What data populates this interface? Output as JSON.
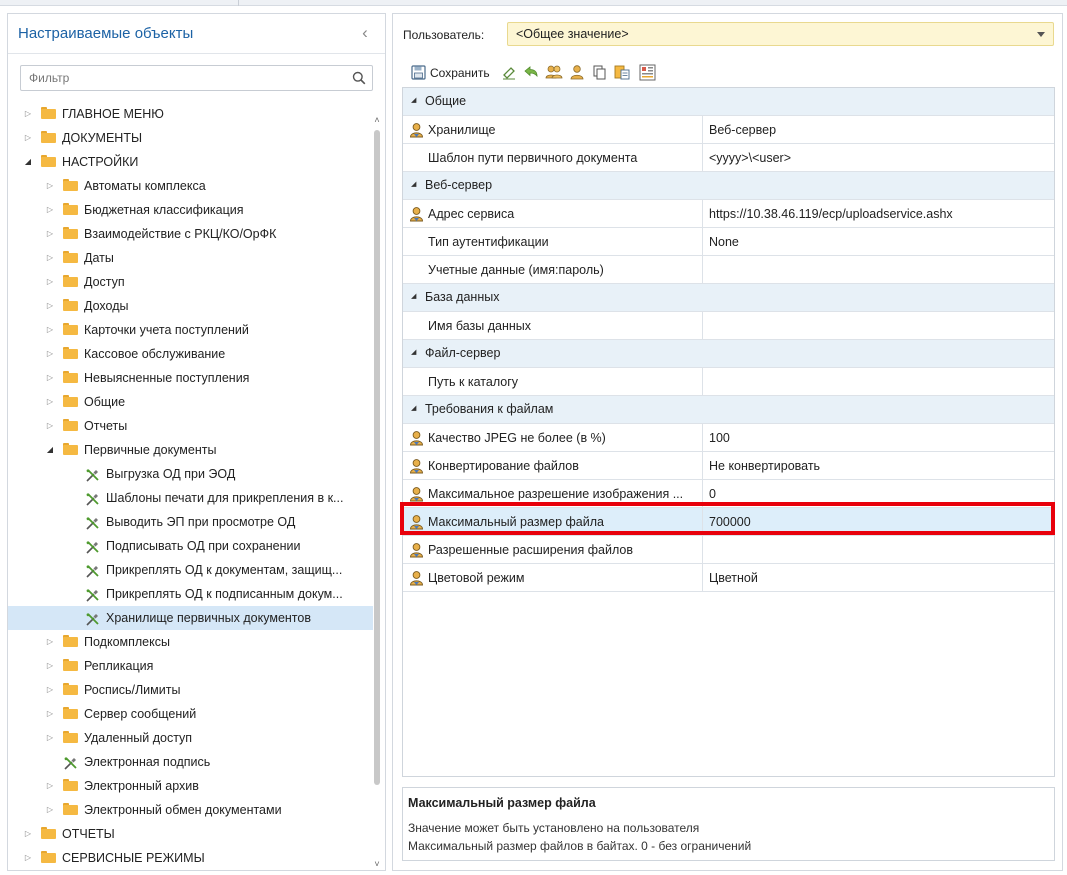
{
  "left_panel": {
    "title": "Настраиваемые объекты",
    "filter_placeholder": "Фильтр",
    "tree": [
      {
        "label": "ГЛАВНОЕ МЕНЮ",
        "level": 0,
        "type": "folder",
        "expanded": false
      },
      {
        "label": "ДОКУМЕНТЫ",
        "level": 0,
        "type": "folder",
        "expanded": false
      },
      {
        "label": "НАСТРОЙКИ",
        "level": 0,
        "type": "folder",
        "expanded": true
      },
      {
        "label": "Автоматы комплекса",
        "level": 1,
        "type": "folder",
        "expanded": false
      },
      {
        "label": "Бюджетная классификация",
        "level": 1,
        "type": "folder",
        "expanded": false
      },
      {
        "label": "Взаимодействие с РКЦ/КО/ОрФК",
        "level": 1,
        "type": "folder",
        "expanded": false
      },
      {
        "label": "Даты",
        "level": 1,
        "type": "folder",
        "expanded": false
      },
      {
        "label": "Доступ",
        "level": 1,
        "type": "folder",
        "expanded": false
      },
      {
        "label": "Доходы",
        "level": 1,
        "type": "folder",
        "expanded": false
      },
      {
        "label": "Карточки учета поступлений",
        "level": 1,
        "type": "folder",
        "expanded": false
      },
      {
        "label": "Кассовое обслуживание",
        "level": 1,
        "type": "folder",
        "expanded": false
      },
      {
        "label": "Невыясненные поступления",
        "level": 1,
        "type": "folder",
        "expanded": false
      },
      {
        "label": "Общие",
        "level": 1,
        "type": "folder",
        "expanded": false
      },
      {
        "label": "Отчеты",
        "level": 1,
        "type": "folder",
        "expanded": false
      },
      {
        "label": "Первичные документы",
        "level": 1,
        "type": "folder",
        "expanded": true
      },
      {
        "label": "Выгрузка ОД при ЭОД",
        "level": 2,
        "type": "setting"
      },
      {
        "label": "Шаблоны печати для прикрепления в к...",
        "level": 2,
        "type": "setting"
      },
      {
        "label": "Выводить ЭП при просмотре ОД",
        "level": 2,
        "type": "setting"
      },
      {
        "label": "Подписывать ОД при сохранении",
        "level": 2,
        "type": "setting"
      },
      {
        "label": "Прикреплять ОД к документам, защищ...",
        "level": 2,
        "type": "setting"
      },
      {
        "label": "Прикреплять ОД к подписанным докум...",
        "level": 2,
        "type": "setting"
      },
      {
        "label": "Хранилище первичных документов",
        "level": 2,
        "type": "setting",
        "selected": true
      },
      {
        "label": "Подкомплексы",
        "level": 1,
        "type": "folder",
        "expanded": false
      },
      {
        "label": "Репликация",
        "level": 1,
        "type": "folder",
        "expanded": false
      },
      {
        "label": "Роспись/Лимиты",
        "level": 1,
        "type": "folder",
        "expanded": false
      },
      {
        "label": "Сервер сообщений",
        "level": 1,
        "type": "folder",
        "expanded": false
      },
      {
        "label": "Удаленный доступ",
        "level": 1,
        "type": "folder",
        "expanded": false
      },
      {
        "label": "Электронная подпись",
        "level": 1,
        "type": "setting"
      },
      {
        "label": "Электронный архив",
        "level": 1,
        "type": "folder",
        "expanded": false
      },
      {
        "label": "Электронный обмен документами",
        "level": 1,
        "type": "folder",
        "expanded": false
      },
      {
        "label": "ОТЧЕТЫ",
        "level": 0,
        "type": "folder",
        "expanded": false
      },
      {
        "label": "СЕРВИСНЫЕ РЕЖИМЫ",
        "level": 0,
        "type": "folder",
        "expanded": false
      }
    ]
  },
  "right_panel": {
    "user_label": "Пользователь:",
    "user_value": "<Общее значение>",
    "toolbar": {
      "save_label": "Сохранить"
    },
    "properties": [
      {
        "type": "group",
        "label": "Общие"
      },
      {
        "type": "prop",
        "name": "Хранилище",
        "value": "Веб-сервер",
        "user_icon": true
      },
      {
        "type": "prop",
        "name": "Шаблон пути первичного документа",
        "value": "<yyyy>\\<user>",
        "user_icon": false
      },
      {
        "type": "group",
        "label": "Веб-сервер"
      },
      {
        "type": "prop",
        "name": "Адрес сервиса",
        "value": "https://10.38.46.119/ecp/uploadservice.ashx",
        "user_icon": true
      },
      {
        "type": "prop",
        "name": "Тип аутентификации",
        "value": "None",
        "user_icon": false
      },
      {
        "type": "prop",
        "name": "Учетные данные (имя:пароль)",
        "value": "",
        "user_icon": false
      },
      {
        "type": "group",
        "label": "База данных"
      },
      {
        "type": "prop",
        "name": "Имя базы данных",
        "value": "",
        "user_icon": false
      },
      {
        "type": "group",
        "label": "Файл-сервер"
      },
      {
        "type": "prop",
        "name": "Путь к каталогу",
        "value": "",
        "user_icon": false
      },
      {
        "type": "group",
        "label": "Требования к файлам"
      },
      {
        "type": "prop",
        "name": "Качество JPEG не более (в %)",
        "value": "100",
        "user_icon": true
      },
      {
        "type": "prop",
        "name": "Конвертирование файлов",
        "value": "Не конвертировать",
        "user_icon": true
      },
      {
        "type": "prop",
        "name": "Максимальное разрешение изображения ...",
        "value": "0",
        "user_icon": true
      },
      {
        "type": "prop",
        "name": "Максимальный размер файла",
        "value": "700000",
        "user_icon": true,
        "highlighted": true
      },
      {
        "type": "prop",
        "name": "Разрешенные расширения файлов",
        "value": "",
        "user_icon": true
      },
      {
        "type": "prop",
        "name": "Цветовой режим",
        "value": "Цветной",
        "user_icon": true
      }
    ],
    "description": {
      "title": "Максимальный размер файла",
      "line1": "Значение может быть установлено на пользователя",
      "line2": "Максимальный размер файлов в байтах. 0 - без ограничений"
    }
  },
  "colors": {
    "accent_title": "#1c62a5",
    "selection": "#d5e7f7",
    "group_row": "#e8f1f8",
    "highlight_border": "#e8000b",
    "user_select_bg": "#fdf6d4"
  }
}
